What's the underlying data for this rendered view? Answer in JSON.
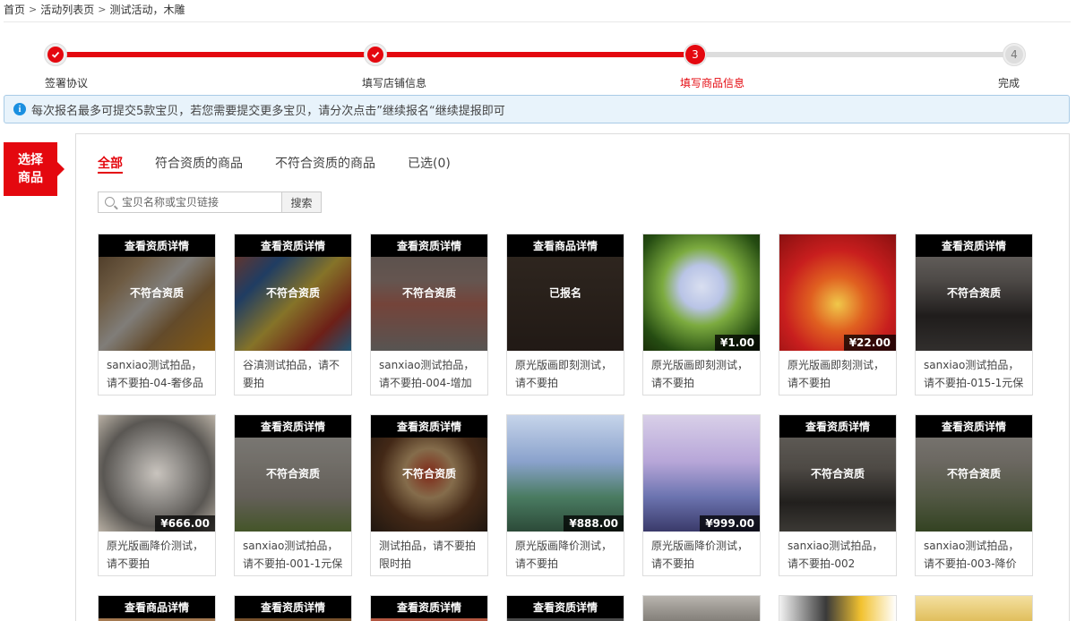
{
  "breadcrumb": [
    "首页",
    "活动列表页",
    "测试活动，木雕"
  ],
  "steps": [
    {
      "label": "签署协议",
      "state": "done"
    },
    {
      "label": "填写店铺信息",
      "state": "done"
    },
    {
      "label": "填写商品信息",
      "state": "current",
      "num": "3"
    },
    {
      "label": "完成",
      "state": "todo",
      "num": "4"
    }
  ],
  "notice": "每次报名最多可提交5款宝贝，若您需要提交更多宝贝，请分次点击”继续报名“继续提报即可",
  "side_tag": "选择商品",
  "tabs": [
    "全部",
    "符合资质的商品",
    "不符合资质的商品",
    "已选(0)"
  ],
  "search": {
    "placeholder": "宝贝名称或宝贝链接",
    "button": "搜索"
  },
  "colors": {
    "accent": "#e4080f",
    "notice_bg": "#e8f3fb"
  },
  "cards": [
    {
      "topbar": "查看资质详情",
      "status": "不符合资质",
      "price": "",
      "title": "sanxiao测试拍品，请不要拍-04-奢侈品"
    },
    {
      "topbar": "查看资质详情",
      "status": "不符合资质",
      "price": "",
      "title": "谷滇测试拍品，请不要拍"
    },
    {
      "topbar": "查看资质详情",
      "status": "不符合资质",
      "price": "",
      "title": "sanxiao测试拍品，请不要拍-004-增加"
    },
    {
      "topbar": "查看商品详情",
      "status": "已报名",
      "price": "",
      "title": "原光版画即刻测试，请不要拍"
    },
    {
      "topbar": "",
      "status": "",
      "price": "¥1.00",
      "title": "原光版画即刻测试，请不要拍"
    },
    {
      "topbar": "",
      "status": "",
      "price": "¥22.00",
      "title": "原光版画即刻测试，请不要拍"
    },
    {
      "topbar": "查看资质详情",
      "status": "不符合资质",
      "price": "",
      "title": "sanxiao测试拍品，请不要拍-015-1元保"
    },
    {
      "topbar": "",
      "status": "",
      "price": "¥666.00",
      "title": "原光版画降价测试，请不要拍"
    },
    {
      "topbar": "查看资质详情",
      "status": "不符合资质",
      "price": "",
      "title": "sanxiao测试拍品，请不要拍-001-1元保"
    },
    {
      "topbar": "查看资质详情",
      "status": "不符合资质",
      "price": "",
      "title": "测试拍品，请不要拍限时拍"
    },
    {
      "topbar": "",
      "status": "",
      "price": "¥888.00",
      "title": "原光版画降价测试，请不要拍"
    },
    {
      "topbar": "",
      "status": "",
      "price": "¥999.00",
      "title": "原光版画降价测试，请不要拍"
    },
    {
      "topbar": "查看资质详情",
      "status": "不符合资质",
      "price": "",
      "title": "sanxiao测试拍品，请不要拍-002"
    },
    {
      "topbar": "查看资质详情",
      "status": "不符合资质",
      "price": "",
      "title": "sanxiao测试拍品，请不要拍-003-降价"
    }
  ],
  "cards_row3": [
    {
      "topbar": "查看商品详情"
    },
    {
      "topbar": "查看资质详情"
    },
    {
      "topbar": "查看资质详情"
    },
    {
      "topbar": "查看资质详情"
    },
    {
      "topbar": ""
    },
    {
      "topbar": ""
    },
    {
      "topbar": ""
    }
  ]
}
